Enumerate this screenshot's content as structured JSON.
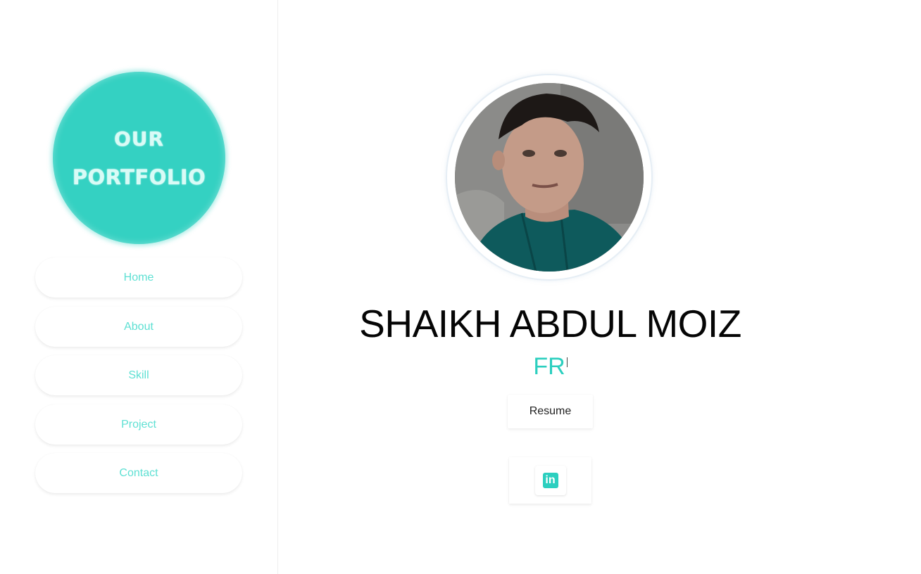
{
  "sidebar": {
    "logo": {
      "line1": "OUR",
      "line2": "PORTFOLIO"
    },
    "nav": [
      {
        "label": "Home"
      },
      {
        "label": "About"
      },
      {
        "label": "Skill"
      },
      {
        "label": "Project"
      },
      {
        "label": "Contact"
      }
    ]
  },
  "hero": {
    "name": "SHAIKH ABDUL MOIZ",
    "typed_text": "FR",
    "resume_label": "Resume",
    "social": {
      "icon": "linkedin-icon",
      "glyph": "in"
    }
  },
  "colors": {
    "accent": "#2ccfbf",
    "logo_bg": "#34d1c2",
    "nav_text": "#5ee0d3"
  }
}
